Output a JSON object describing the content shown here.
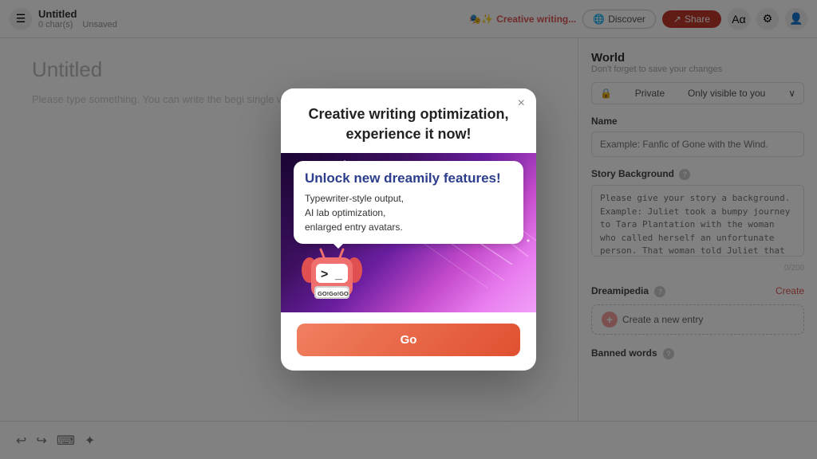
{
  "header": {
    "title": "Untitled",
    "char_count": "0 char(s)",
    "unsaved": "Unsaved",
    "brand": "Creative writing...",
    "discover_label": "Discover",
    "share_label": "Share"
  },
  "editor": {
    "title": "Untitled",
    "placeholder": "Please type something. You can write the begi single word or the name of the main character."
  },
  "sidebar": {
    "section_title": "World",
    "section_sub": "Don't forget to save your changes",
    "visibility": "Private",
    "visibility_note": "Only visible to you",
    "name_label": "Name",
    "name_placeholder": "Example: Fanfic of Gone with the Wind.",
    "story_bg_label": "Story Background",
    "story_bg_placeholder": "Please give your story a background. Example: Juliet took a bumpy journey to Tara Plantation with the woman who called herself an unfortunate person. That woman told Juliet that in Tara, she would never suffer from the misery of love anymore and that she could do",
    "char_limit": "0/200",
    "dreamipedia_label": "Dreamipedia",
    "create_label": "Create",
    "create_entry_label": "Create a new entry",
    "banned_label": "Banned words"
  },
  "modal": {
    "title": "Creative writing optimization, experience it now!",
    "bubble_title": "Unlock new dreamily features!",
    "bubble_body": "Typewriter-style output,\nAI lab optimization,\nenlarged entry avatars.",
    "go_label": "Go",
    "close_label": "×"
  },
  "toolbar": {
    "undo_icon": "↩",
    "redo_icon": "↪",
    "keyboard_icon": "⌨",
    "sparkle_icon": "✦"
  }
}
